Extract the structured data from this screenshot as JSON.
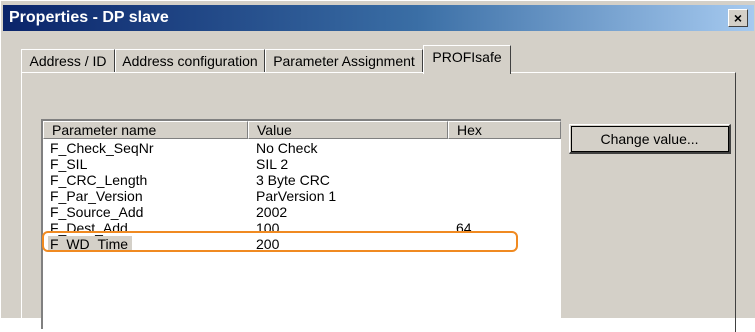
{
  "window": {
    "title": "Properties - DP slave",
    "close_label": "×"
  },
  "tabs": [
    {
      "label": "Address / ID"
    },
    {
      "label": "Address configuration"
    },
    {
      "label": "Parameter Assignment"
    },
    {
      "label": "PROFIsafe",
      "active": true
    }
  ],
  "table": {
    "columns": [
      "Parameter name",
      "Value",
      "Hex"
    ],
    "rows": [
      {
        "name": "F_Check_SeqNr",
        "value": "No Check",
        "hex": ""
      },
      {
        "name": "F_SIL",
        "value": "SIL 2",
        "hex": ""
      },
      {
        "name": "F_CRC_Length",
        "value": "3 Byte CRC",
        "hex": ""
      },
      {
        "name": "F_Par_Version",
        "value": "ParVersion 1",
        "hex": ""
      },
      {
        "name": "F_Source_Add",
        "value": "2002",
        "hex": ""
      },
      {
        "name": "F_Dest_Add",
        "value": "100",
        "hex": "64",
        "highlighted": true
      },
      {
        "name": "F_WD_Time",
        "value": "200",
        "hex": "",
        "selected": true
      }
    ]
  },
  "buttons": {
    "change_value": "Change value..."
  },
  "colors": {
    "highlight_outline": "#f08a21",
    "titlebar_start": "#0a246a",
    "titlebar_end": "#a6caf0"
  }
}
